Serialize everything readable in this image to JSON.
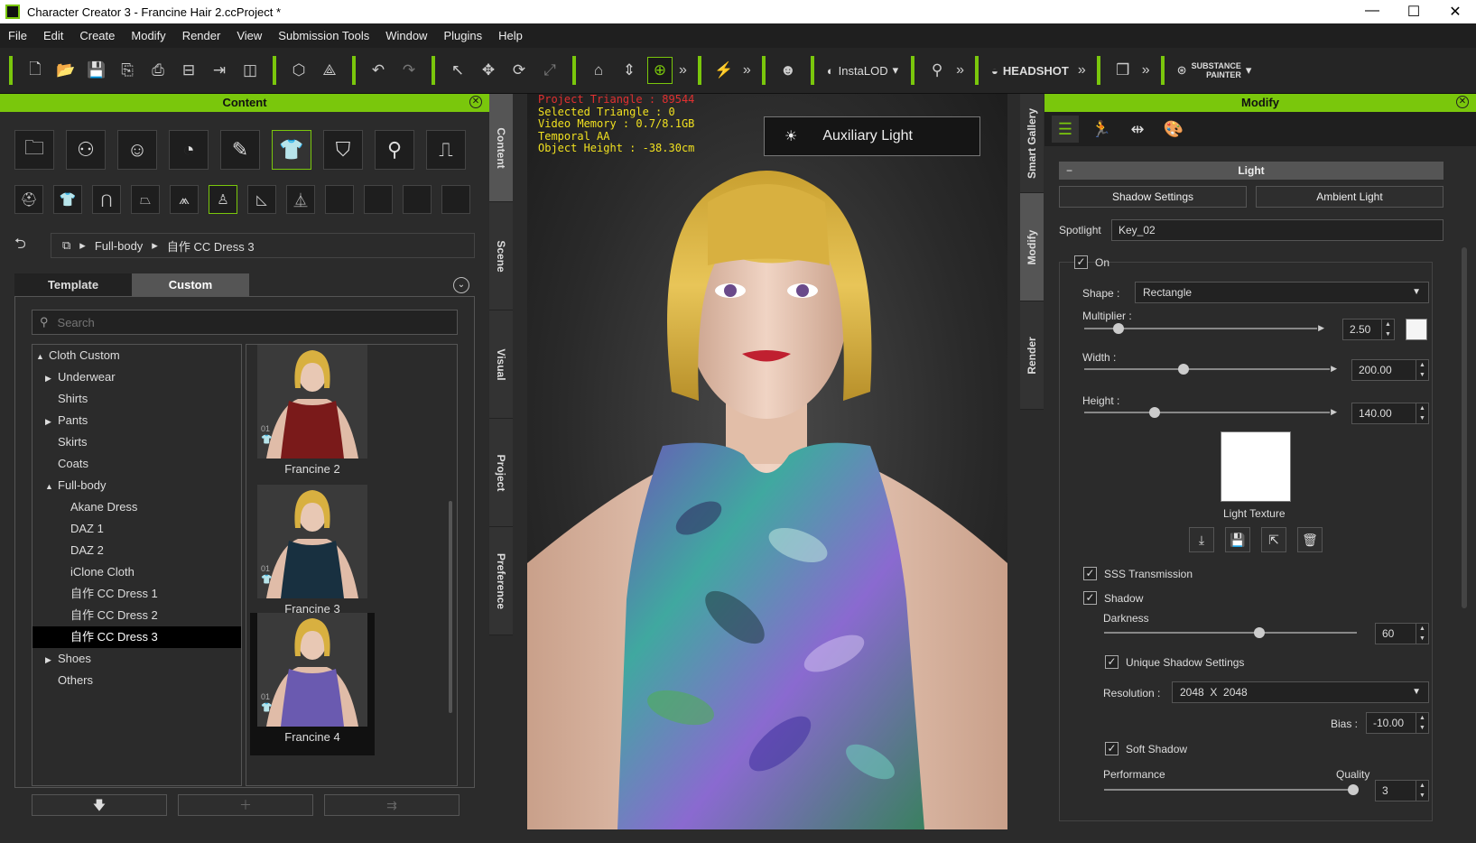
{
  "window": {
    "title": "Character Creator 3 - Francine Hair 2.ccProject *",
    "controls": [
      "—",
      "☐",
      "✕"
    ]
  },
  "menu": [
    "File",
    "Edit",
    "Create",
    "Modify",
    "Render",
    "View",
    "Submission Tools",
    "Window",
    "Plugins",
    "Help"
  ],
  "toolbar": {
    "instalod": "InstaLOD",
    "headshot": "HEADSHOT",
    "substance_line1": "SUBSTANCE",
    "substance_line2": "PAINTER"
  },
  "content": {
    "title": "Content",
    "breadcrumb": [
      "Full-body",
      "自作 CC Dress 3"
    ],
    "tabs": [
      "Template",
      "Custom"
    ],
    "search_placeholder": "Search",
    "tree": [
      {
        "label": "Cloth Custom",
        "level": 0,
        "arrow": "▲"
      },
      {
        "label": "Underwear",
        "level": 1,
        "arrow": "▶"
      },
      {
        "label": "Shirts",
        "level": 1,
        "arrow": ""
      },
      {
        "label": "Pants",
        "level": 1,
        "arrow": "▶"
      },
      {
        "label": "Skirts",
        "level": 1,
        "arrow": ""
      },
      {
        "label": "Coats",
        "level": 1,
        "arrow": ""
      },
      {
        "label": "Full-body",
        "level": 1,
        "arrow": "▲"
      },
      {
        "label": "Akane Dress",
        "level": 2,
        "arrow": ""
      },
      {
        "label": "DAZ 1",
        "level": 2,
        "arrow": ""
      },
      {
        "label": "DAZ 2",
        "level": 2,
        "arrow": ""
      },
      {
        "label": "iClone Cloth",
        "level": 2,
        "arrow": ""
      },
      {
        "label": "自作 CC Dress 1",
        "level": 2,
        "arrow": ""
      },
      {
        "label": "自作 CC Dress 2",
        "level": 2,
        "arrow": ""
      },
      {
        "label": "自作 CC Dress 3",
        "level": 2,
        "arrow": "",
        "selected": true
      },
      {
        "label": "Shoes",
        "level": 1,
        "arrow": "▶"
      },
      {
        "label": "Others",
        "level": 1,
        "arrow": ""
      }
    ],
    "thumbnails": [
      {
        "label": "Francine 2",
        "tag": "01",
        "dress": "#7a1a1a"
      },
      {
        "label": "Francine 3",
        "tag": "01",
        "dress": "#183040"
      },
      {
        "label": "Francine 4",
        "tag": "01",
        "dress": "#6a5ab0",
        "selected": true
      }
    ]
  },
  "left_tabs": [
    "Content",
    "Scene",
    "Visual",
    "Project",
    "Preference"
  ],
  "right_tabs": [
    "Smart Gallery",
    "Modify",
    "Render"
  ],
  "viewport": {
    "stats": {
      "project_triangle": "Project Triangle : 89544",
      "selected_triangle": "Selected Triangle : 0",
      "video_memory": "Video Memory : 0.7/8.1GB",
      "temporal_aa": "Temporal AA",
      "object_height": "Object Height : -38.30cm"
    },
    "aux_light": "Auxiliary Light"
  },
  "modify": {
    "title": "Modify",
    "section": "Light",
    "shadow_settings": "Shadow Settings",
    "ambient_light": "Ambient Light",
    "spotlight_label": "Spotlight",
    "spotlight_value": "Key_02",
    "on_label": "On",
    "shape_label": "Shape :",
    "shape_value": "Rectangle",
    "multiplier_label": "Multiplier :",
    "multiplier_value": "2.50",
    "width_label": "Width :",
    "width_value": "200.00",
    "height_label": "Height :",
    "height_value": "140.00",
    "light_texture": "Light Texture",
    "sss_label": "SSS Transmission",
    "shadow_label": "Shadow",
    "darkness_label": "Darkness",
    "darkness_value": "60",
    "unique_shadow": "Unique Shadow Settings",
    "resolution_label": "Resolution :",
    "resolution_value": "2048  X  2048",
    "bias_label": "Bias :",
    "bias_value": "-10.00",
    "soft_shadow": "Soft Shadow",
    "performance": "Performance",
    "quality": "Quality",
    "quality_value": "3"
  }
}
